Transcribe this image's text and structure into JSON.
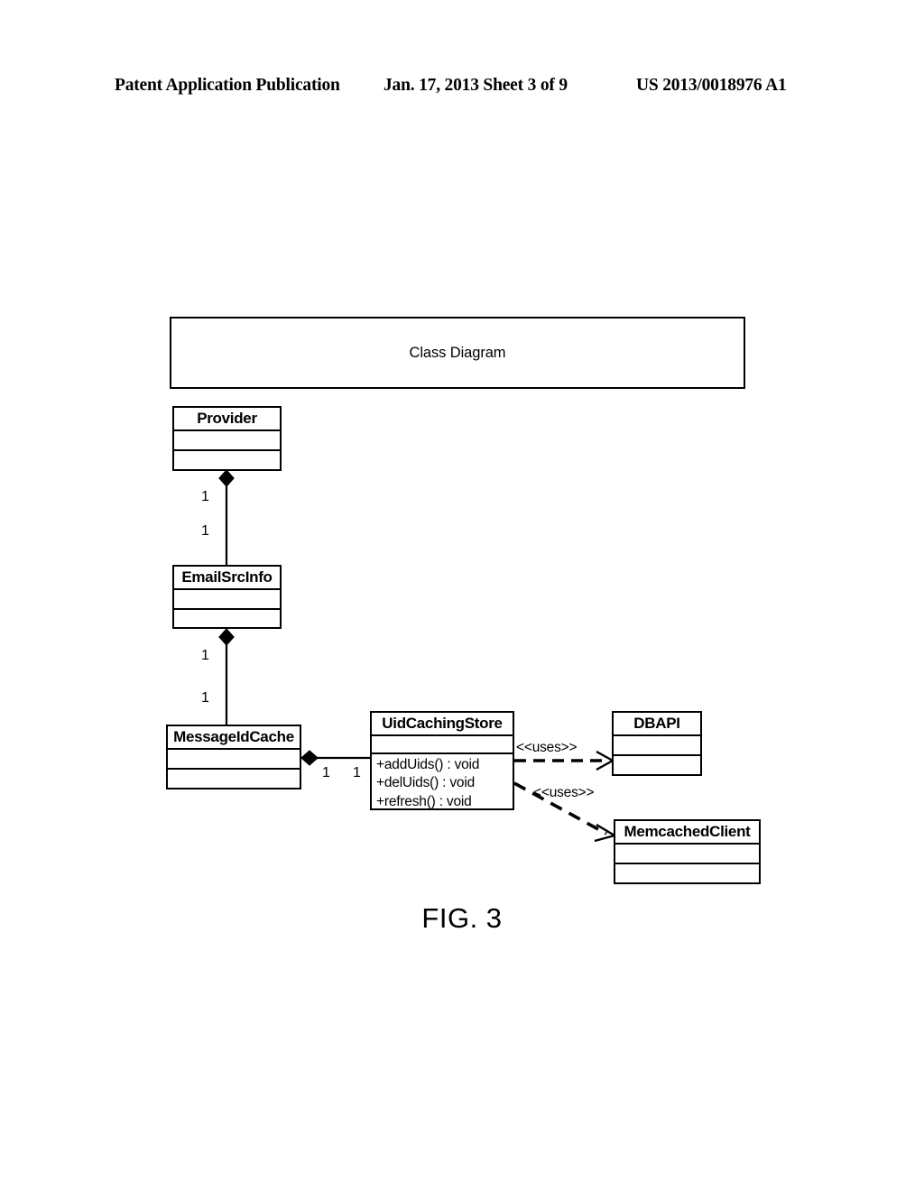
{
  "page": {
    "header": {
      "publication": "Patent Application Publication",
      "date_sheet": "Jan. 17, 2013  Sheet 3 of 9",
      "document_id": "US 2013/0018976 A1"
    },
    "figure_caption": "FIG. 3"
  },
  "diagram": {
    "frame_title": "Class Diagram",
    "type": "uml-class-diagram",
    "classes": [
      {
        "id": "provider",
        "name": "Provider",
        "attributes": [],
        "operations": []
      },
      {
        "id": "email-src-info",
        "name": "EmailSrcInfo",
        "attributes": [],
        "operations": []
      },
      {
        "id": "message-id-cache",
        "name": "MessageIdCache",
        "attributes": [],
        "operations": []
      },
      {
        "id": "uid-caching-store",
        "name": "UidCachingStore",
        "attributes": [],
        "operations": [
          "+addUids() : void",
          "+delUids() : void",
          "+refresh() : void"
        ]
      },
      {
        "id": "dbapi",
        "name": "DBAPI",
        "attributes": [],
        "operations": []
      },
      {
        "id": "memcached-client",
        "name": "MemcachedClient",
        "attributes": [],
        "operations": []
      }
    ],
    "relationships": [
      {
        "id": "provider-emailsrcinfo",
        "kind": "composition",
        "from": "provider",
        "to": "email-src-info",
        "from_multiplicity": "1",
        "to_multiplicity": "1"
      },
      {
        "id": "emailsrcinfo-messageidcache",
        "kind": "composition",
        "from": "email-src-info",
        "to": "message-id-cache",
        "from_multiplicity": "1",
        "to_multiplicity": "1"
      },
      {
        "id": "messageidcache-uidcachingstore",
        "kind": "composition",
        "from": "message-id-cache",
        "to": "uid-caching-store",
        "from_multiplicity": "1",
        "to_multiplicity": "1"
      },
      {
        "id": "uidcachingstore-dbapi",
        "kind": "dependency",
        "from": "uid-caching-store",
        "to": "dbapi",
        "stereotype": "<<uses>>"
      },
      {
        "id": "uidcachingstore-memcachedclient",
        "kind": "dependency",
        "from": "uid-caching-store",
        "to": "memcached-client",
        "stereotype": "<<uses>>"
      }
    ]
  },
  "colors": {
    "line": "#000000",
    "background": "#ffffff"
  }
}
